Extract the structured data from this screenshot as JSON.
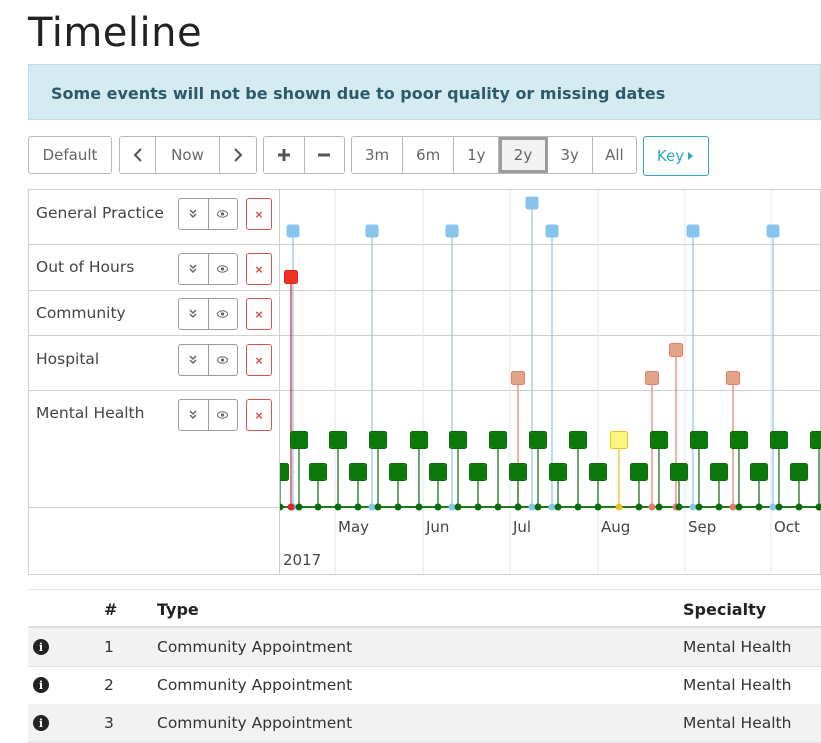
{
  "page": {
    "title": "Timeline"
  },
  "alert": {
    "text": "Some events will not be shown due to poor quality or missing dates"
  },
  "toolbar": {
    "default_label": "Default",
    "prev_icon": "chevron-left-icon",
    "now_label": "Now",
    "next_icon": "chevron-right-icon",
    "zoom_in_icon": "plus-icon",
    "zoom_out_icon": "minus-icon",
    "ranges": [
      "3m",
      "6m",
      "1y",
      "2y",
      "3y",
      "All"
    ],
    "active_range": "2y",
    "key_label": "Key"
  },
  "timeline": {
    "rows": [
      {
        "label": "General Practice"
      },
      {
        "label": "Out of Hours"
      },
      {
        "label": "Community"
      },
      {
        "label": "Hospital"
      },
      {
        "label": "Mental Health"
      }
    ],
    "row_controls": {
      "collapse_icon": "chevrons-down-icon",
      "view_icon": "eye-icon",
      "remove_label": "×"
    },
    "months": [
      "May",
      "Jun",
      "Jul",
      "Aug",
      "Sep",
      "Oct"
    ],
    "year": "2017",
    "colors": {
      "general_practice": "#87c5ef",
      "out_of_hours": "#ee3322",
      "hospital": "#e0a587",
      "mental_health": "#0b7a0b",
      "highlight": "#fff57a"
    }
  },
  "table": {
    "headers": {
      "num": "#",
      "type": "Type",
      "specialty": "Specialty"
    },
    "rows": [
      {
        "num": "1",
        "type": "Community Appointment",
        "specialty": "Mental Health"
      },
      {
        "num": "2",
        "type": "Community Appointment",
        "specialty": "Mental Health"
      },
      {
        "num": "3",
        "type": "Community Appointment",
        "specialty": "Mental Health"
      }
    ]
  }
}
